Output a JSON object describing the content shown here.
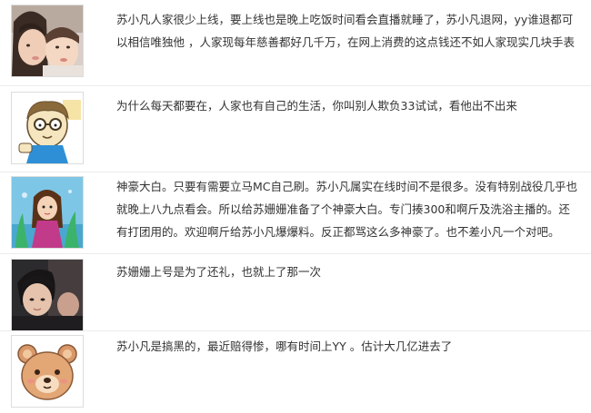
{
  "comments": [
    {
      "avatar": "toddler-kissing-photo",
      "lines": [
        "苏小凡人家很少上线，要上线也是晚上吃饭时间看会直播就睡了，苏小凡退网，yy谁退都可",
        "以相信唯独他 ，人家现每年慈善都好几千万，在网上消费的这点钱还不如人家现实几块手表"
      ]
    },
    {
      "avatar": "cartoon-glasses-boy",
      "lines": [
        "为什么每天都要在，人家也有自己的生活，你叫别人欺负33试试，看他出不出来"
      ]
    },
    {
      "avatar": "cartoon-girl-aquarium",
      "lines": [
        "神豪大白。只要有需要立马MC自己刷。苏小凡属实在线时间不是很多。没有特别战役几乎也",
        "就晚上八九点看会。所以给苏姗姗准备了个神豪大白。专门揍300和啊斤及洗浴主播的。还",
        "有打团用的。欢迎啊斤给苏小凡爆爆料。反正都骂这么多神豪了。也不差小凡一个对吧。"
      ]
    },
    {
      "avatar": "dark-selfie-photo",
      "lines": [
        "苏姗姗上号是为了还礼，也就上了那一次"
      ]
    },
    {
      "avatar": "cartoon-bear",
      "lines": [
        "苏小凡是搞黑的，最近赔得惨，哪有时间上YY 。估计大几亿进去了"
      ]
    }
  ]
}
